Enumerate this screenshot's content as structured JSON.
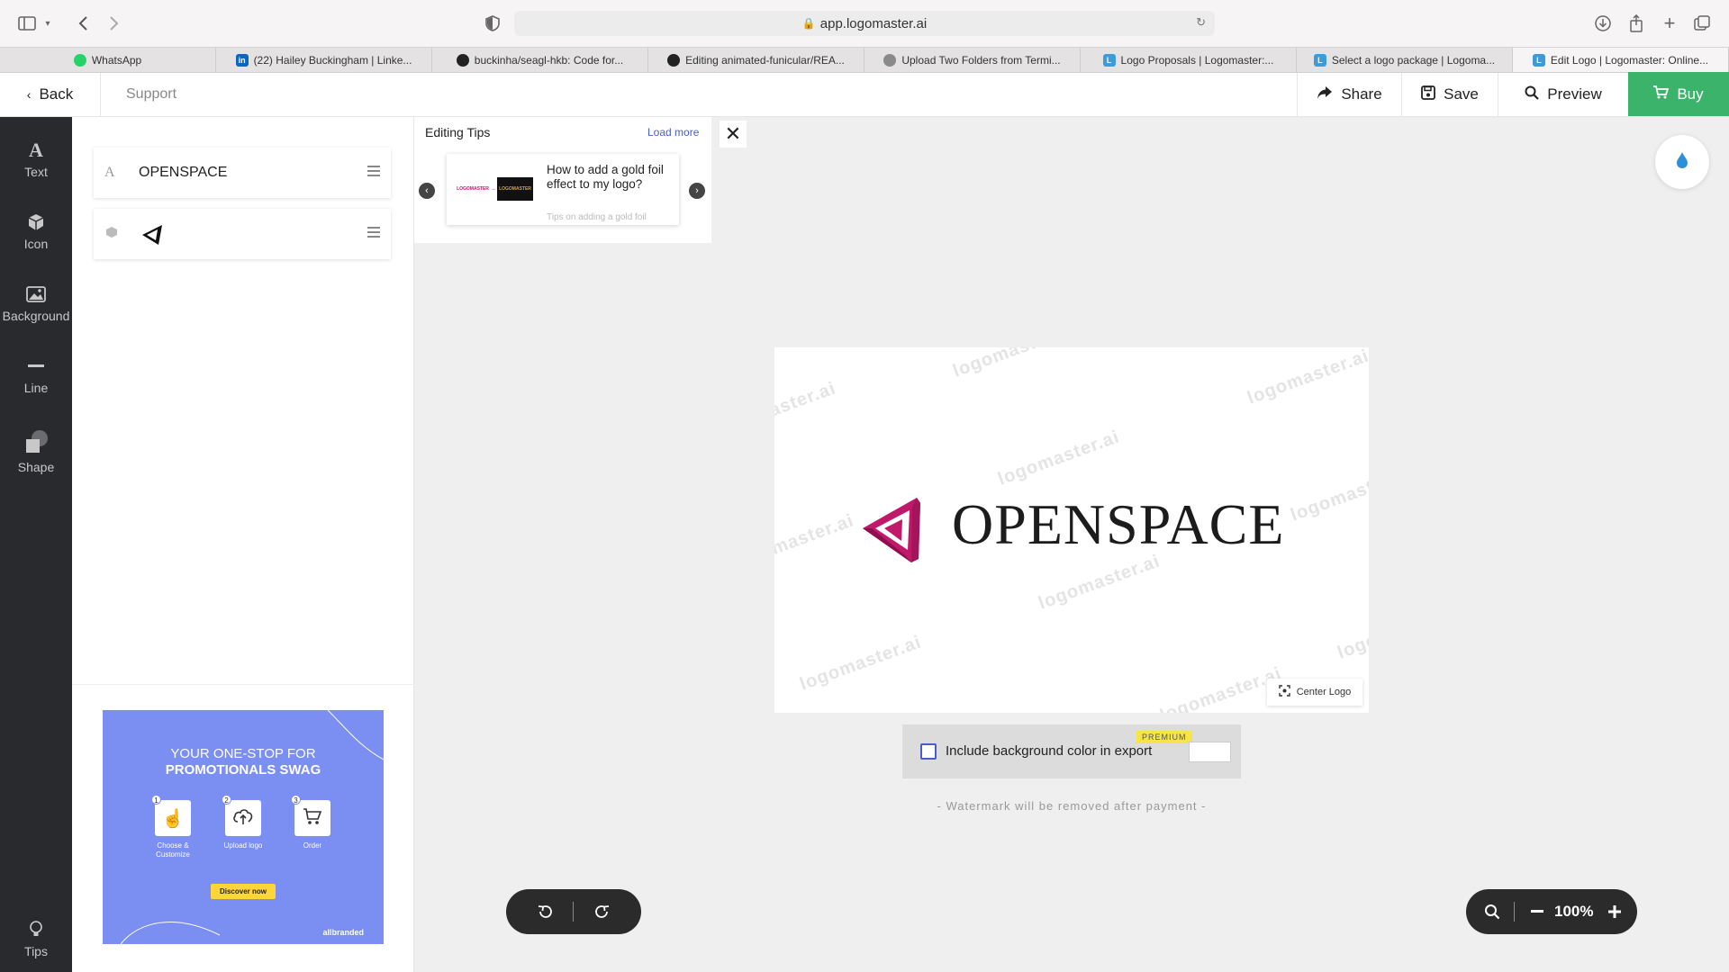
{
  "browser": {
    "url": "app.logomaster.ai",
    "tabs": [
      {
        "label": "WhatsApp",
        "favicon": "whatsapp-icon",
        "color": "#25d366"
      },
      {
        "label": "(22) Hailey Buckingham | Linke...",
        "favicon": "linkedin-icon",
        "color": "#0a66c2"
      },
      {
        "label": "buckinha/seagl-hkb: Code for...",
        "favicon": "github-icon",
        "color": "#222222"
      },
      {
        "label": "Editing animated-funicular/REA...",
        "favicon": "github-icon",
        "color": "#222222"
      },
      {
        "label": "Upload Two Folders from Termi...",
        "favicon": "chatgpt-icon",
        "color": "#8a8a8a"
      },
      {
        "label": "Logo Proposals | Logomaster:...",
        "favicon": "logomaster-icon",
        "color": "#3d9bd8"
      },
      {
        "label": "Select a logo package | Logoma...",
        "favicon": "logomaster-icon",
        "color": "#3d9bd8"
      },
      {
        "label": "Edit Logo | Logomaster: Online...",
        "favicon": "logomaster-icon",
        "color": "#3d9bd8"
      }
    ]
  },
  "header": {
    "back": "Back",
    "support": "Support",
    "share": "Share",
    "save": "Save",
    "preview": "Preview",
    "buy": "Buy"
  },
  "rail": {
    "text": "Text",
    "icon": "Icon",
    "background": "Background",
    "line": "Line",
    "shape": "Shape",
    "tips": "Tips"
  },
  "layers": {
    "text_layer": "OPENSPACE"
  },
  "ad": {
    "line1": "YOUR ONE-STOP FOR",
    "line2": "PROMOTIONALS SWAG",
    "steps": [
      {
        "num": "1",
        "label": "Choose & Customize"
      },
      {
        "num": "2",
        "label": "Upload logo"
      },
      {
        "num": "3",
        "label": "Order"
      }
    ],
    "cta": "Discover now",
    "brand": "allbranded"
  },
  "tips": {
    "title": "Editing Tips",
    "load_more": "Load more",
    "card_title": "How to add a gold foil effect to my logo?",
    "card_sub": "Tips on adding a gold foil"
  },
  "logo": {
    "text": "OPENSPACE",
    "accent": "#c0186a",
    "watermark": "logomaster.ai",
    "center_btn": "Center Logo"
  },
  "export": {
    "label": "Include background color in export",
    "badge": "PREMIUM",
    "checked": false,
    "note": "- Watermark will be removed after payment -"
  },
  "zoom": {
    "value": "100%"
  },
  "colors": {
    "buy": "#3bb36a",
    "rail": "#282a2e",
    "ad_bg": "#7b8ef2"
  }
}
